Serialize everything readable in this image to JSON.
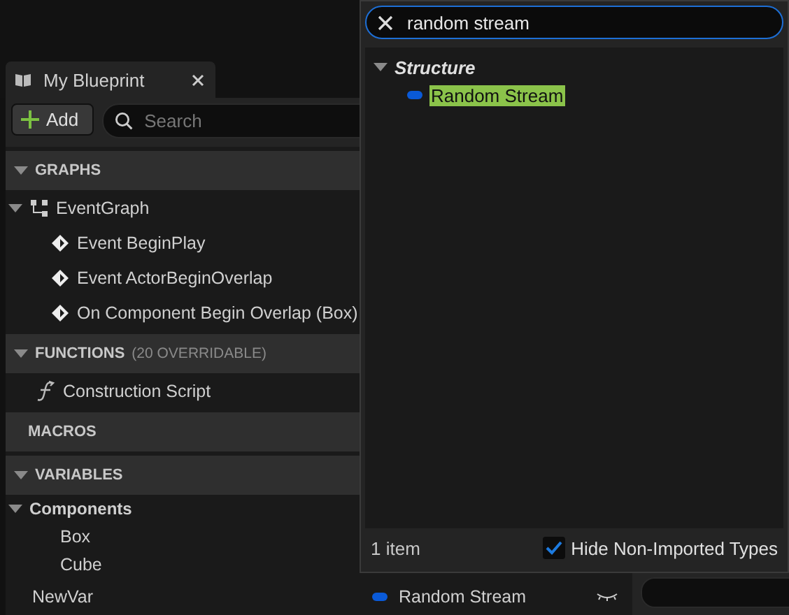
{
  "tab": {
    "title": "My Blueprint"
  },
  "toolbar": {
    "add_button": "Add",
    "search": {
      "placeholder": "Search"
    }
  },
  "sections": [
    {
      "title": "GRAPHS",
      "expanded": true,
      "items": [
        {
          "label": "EventGraph",
          "kind": "graph",
          "expanded": true,
          "children": [
            {
              "label": "Event BeginPlay",
              "kind": "event"
            },
            {
              "label": "Event ActorBeginOverlap",
              "kind": "event"
            },
            {
              "label": "On Component Begin Overlap (Box)",
              "kind": "event"
            }
          ]
        }
      ]
    },
    {
      "title": "FUNCTIONS",
      "note": "(20 OVERRIDABLE)",
      "expanded": true,
      "items": [
        {
          "label": "Construction Script",
          "kind": "function"
        }
      ]
    },
    {
      "title": "MACROS"
    },
    {
      "title": "VARIABLES",
      "expanded": true,
      "items": [
        {
          "label": "Components",
          "kind": "category",
          "expanded": true,
          "children": [
            {
              "label": "Box",
              "kind": "component"
            },
            {
              "label": "Cube",
              "kind": "component"
            }
          ]
        },
        {
          "label": "NewVar",
          "kind": "variable",
          "type": "Random Stream",
          "color": "#0a5ad8"
        }
      ]
    }
  ],
  "popup": {
    "search": {
      "value": "random stream"
    },
    "categories": [
      {
        "label": "Structure",
        "expanded": true,
        "items": [
          {
            "label": "Random Stream",
            "selected": true,
            "color": "#0a5ad8"
          }
        ]
      }
    ],
    "count": "1 item",
    "hide_non_imported": {
      "label": "Hide Non-Imported Types",
      "checked": true
    }
  }
}
